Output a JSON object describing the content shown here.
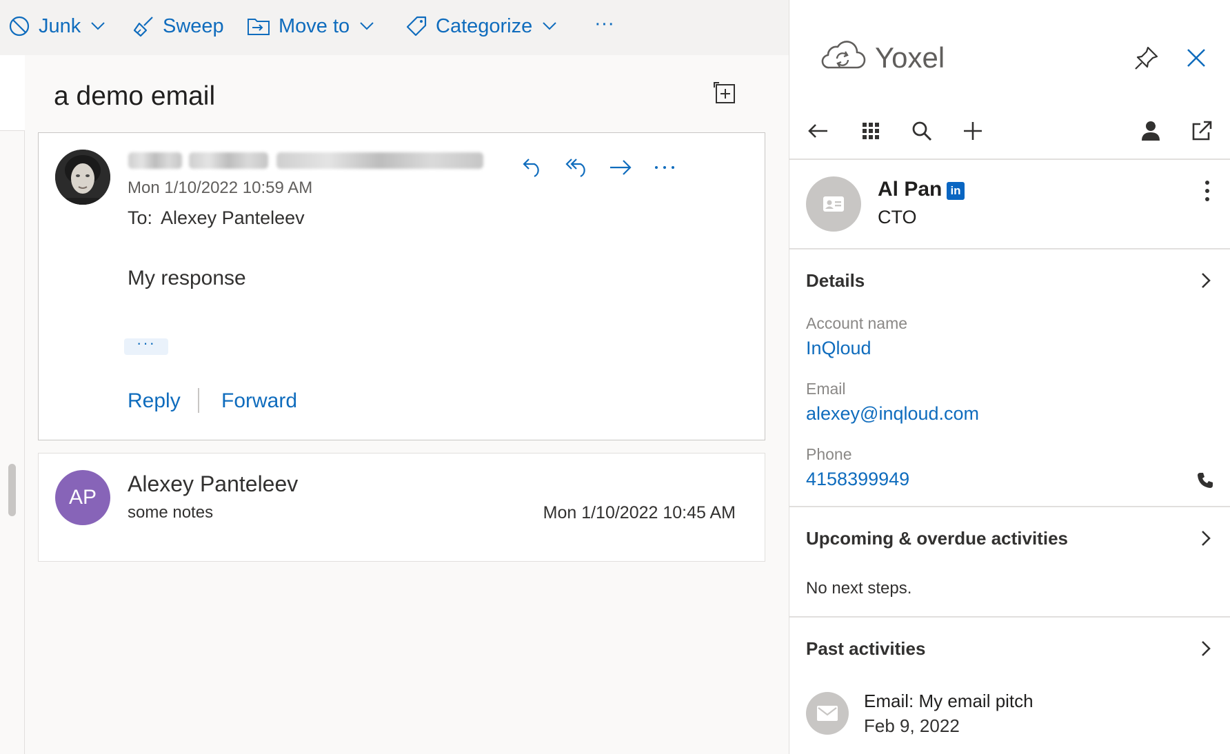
{
  "toolbar": {
    "junk": "Junk",
    "sweep": "Sweep",
    "move_to": "Move to",
    "categorize": "Categorize",
    "more": "···"
  },
  "conversation": {
    "subject": "a demo email",
    "message1": {
      "date": "Mon 1/10/2022 10:59 AM",
      "to_label": "To:",
      "to": "Alexey Panteleev",
      "body": "My response",
      "more": "···",
      "reply": "Reply",
      "forward": "Forward"
    },
    "message2": {
      "avatar_initials": "AP",
      "avatar_color": "#8764b8",
      "sender": "Alexey Panteleev",
      "preview": "some notes",
      "date": "Mon 1/10/2022 10:45 AM"
    }
  },
  "pane": {
    "app_name": "Yoxel",
    "contact": {
      "name": "Al Pan",
      "linkedin": "in",
      "title": "CTO"
    },
    "details": {
      "heading": "Details",
      "account_label": "Account name",
      "account": "InQloud",
      "email_label": "Email",
      "email": "alexey@inqloud.com",
      "phone_label": "Phone",
      "phone": "4158399949"
    },
    "upcoming": {
      "heading": "Upcoming & overdue activities",
      "empty": "No next steps."
    },
    "past": {
      "heading": "Past activities",
      "items": [
        {
          "title": "Email: My email pitch",
          "date": "Feb 9, 2022"
        }
      ]
    }
  },
  "colors": {
    "accent": "#0f6cbd",
    "linkedin": "#0a66c2"
  }
}
